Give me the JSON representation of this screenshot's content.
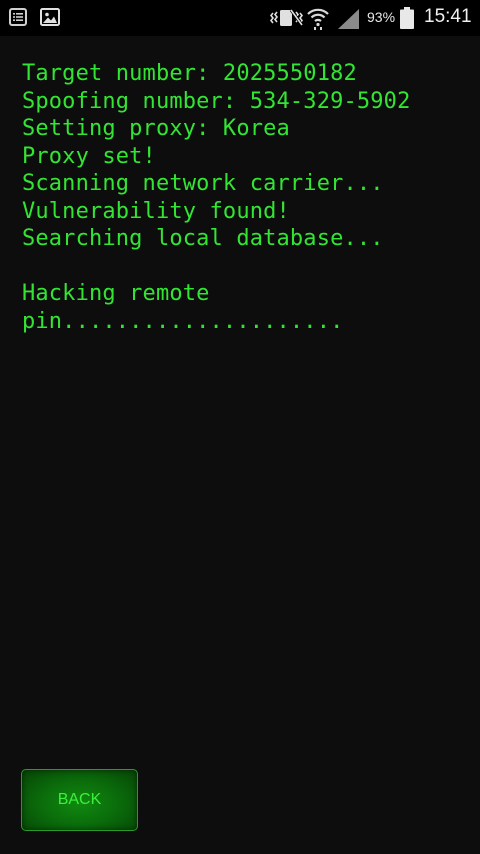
{
  "status_bar": {
    "battery_percent": "93%",
    "time": "15:41",
    "icons": [
      "notification-list-icon",
      "gallery-icon",
      "vibrate-icon",
      "wifi-icon",
      "signal-icon",
      "battery-icon"
    ]
  },
  "terminal": {
    "text_color": "#33e533",
    "lines": [
      "Target number: 2025550182",
      "Spoofing number: 534-329-5902",
      "Setting proxy: Korea",
      "Proxy set!",
      "Scanning network carrier...",
      "Vulnerability found!",
      "Searching local database...",
      "",
      "Hacking remote",
      "pin....................."
    ]
  },
  "back_button": {
    "label": "BACK"
  }
}
